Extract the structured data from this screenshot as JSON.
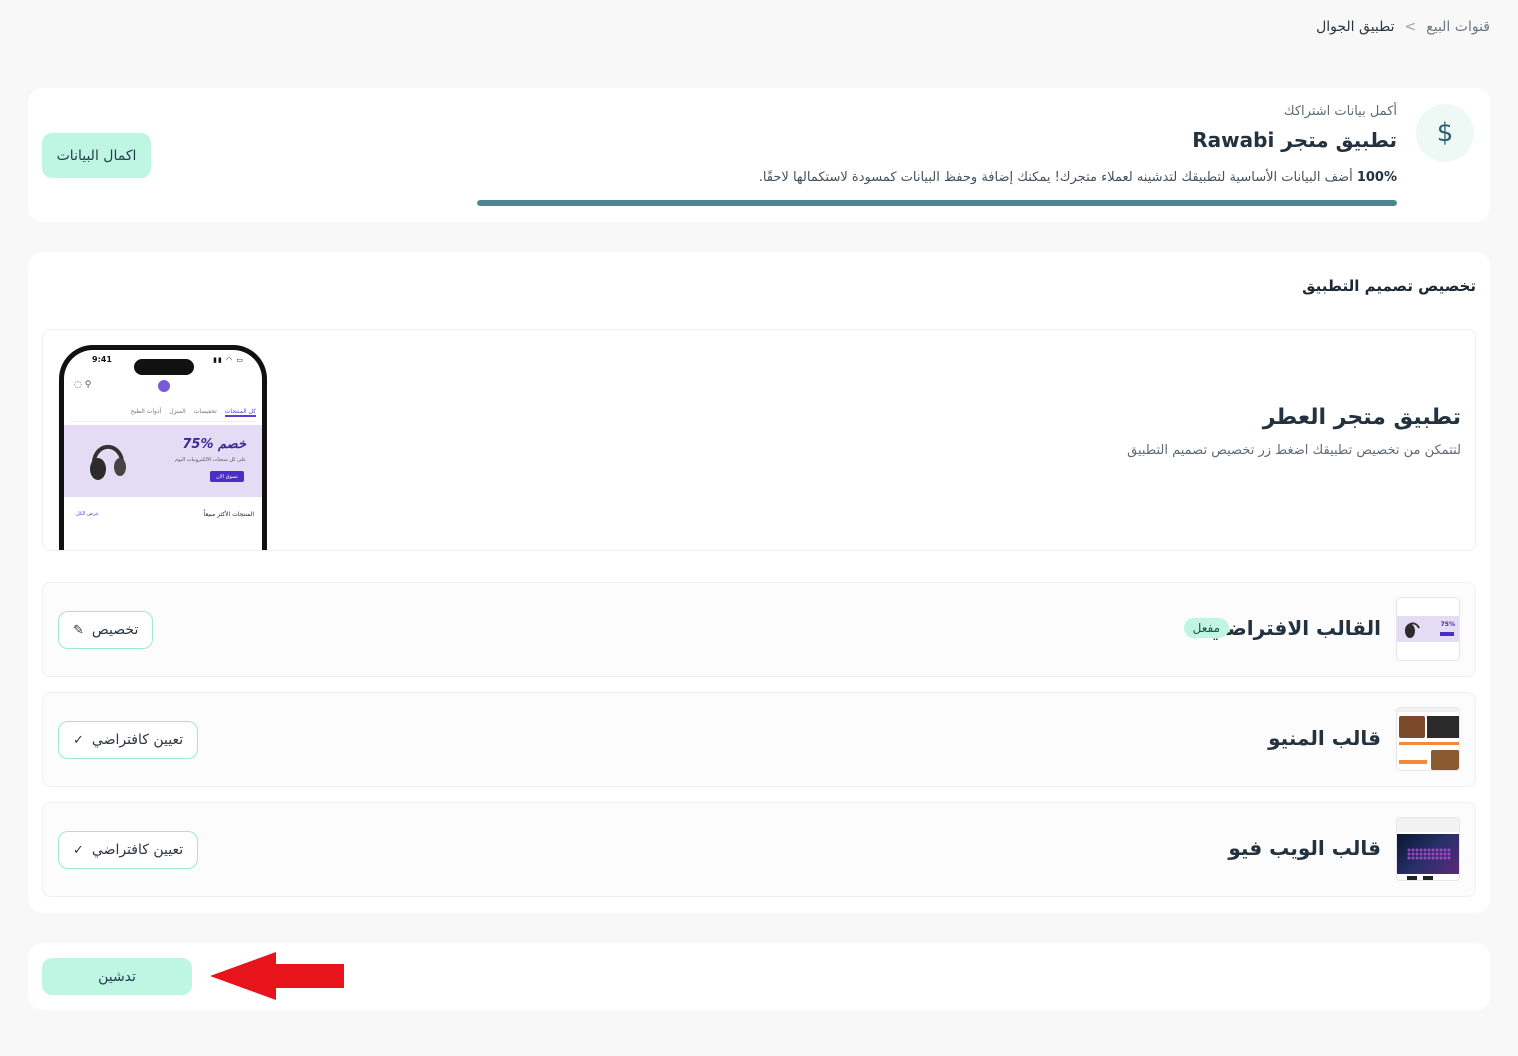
{
  "breadcrumb": {
    "parent": "قنوات البيع",
    "separator": "<",
    "current": "تطبيق الجوال"
  },
  "subscription": {
    "icon": "dollar-icon",
    "hint": "أكمل بيانات اشتراكك",
    "title": "تطبيق متجر Rawabi",
    "percent_label": "100%",
    "description": "أضف البيانات الأساسية لتطبيقك لتدشينه لعملاء متجرك! يمكنك إضافة وحفظ البيانات كمسودة لاستكمالها لاحقًا.",
    "progress": 1.0,
    "complete_button": "اكمال البيانات"
  },
  "design": {
    "heading": "تخصيص تصميم التطبيق",
    "preview": {
      "title": "تطبيق متجر العطر",
      "description": "لتتمكن من تخصيص تطبيقك اضغط زر تخصيص تصميم التطبيق",
      "phone": {
        "time": "9:41",
        "tabs": [
          "كل المنتجات",
          "تخفيضات",
          "المنزل",
          "أدوات الطبخ"
        ],
        "banner_title": "75% خصم",
        "banner_sub": "على كل منتجات الالكترونيات اليوم",
        "banner_button": "تسوق الان",
        "best_sellers": "المنتجات الأكثر مبيعاً",
        "view_all": "عرض الكل"
      }
    },
    "templates": [
      {
        "name": "القالب الافتراضي",
        "badge": "مفعل",
        "action": "تخصيص",
        "action_icon": "edit-icon"
      },
      {
        "name": "قالب المنيو",
        "badge": "",
        "action": "تعيين كافتراضي",
        "action_icon": "check-icon"
      },
      {
        "name": "قالب الويب فيو",
        "badge": "",
        "action": "تعيين كافتراضي",
        "action_icon": "check-icon"
      }
    ]
  },
  "launch": {
    "button": "تدشين"
  },
  "colors": {
    "accent_mint": "#bef6e3",
    "progress": "#4e8595",
    "annotation_arrow": "#e8141c"
  }
}
